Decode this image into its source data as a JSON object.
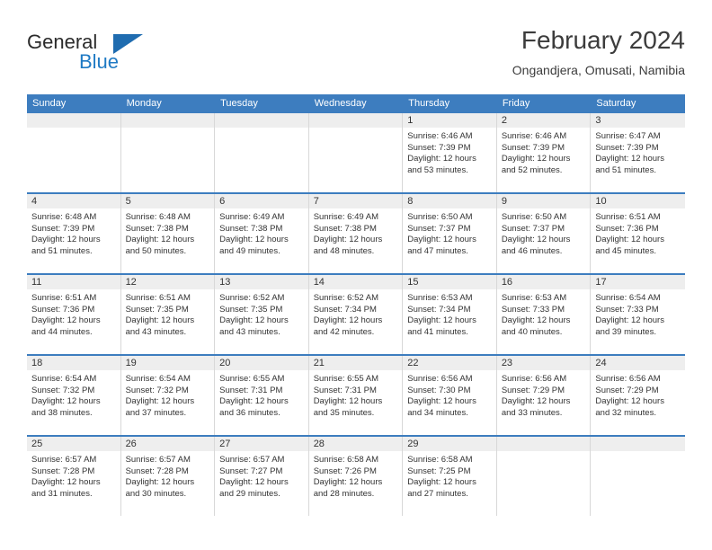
{
  "brand": {
    "line1": "General",
    "line2": "Blue",
    "triangle_icon": "triangle-icon",
    "accent_color": "#1f7ac4"
  },
  "header": {
    "title": "February 2024",
    "subtitle": "Ongandjera, Omusati, Namibia"
  },
  "calendar": {
    "header_color": "#3d7dbf",
    "daynum_bg": "#eeeeee",
    "weekdays": [
      "Sunday",
      "Monday",
      "Tuesday",
      "Wednesday",
      "Thursday",
      "Friday",
      "Saturday"
    ],
    "weeks": [
      [
        {
          "day": "",
          "empty": true
        },
        {
          "day": "",
          "empty": true
        },
        {
          "day": "",
          "empty": true
        },
        {
          "day": "",
          "empty": true
        },
        {
          "day": "1",
          "sunrise": "Sunrise: 6:46 AM",
          "sunset": "Sunset: 7:39 PM",
          "daylight": "Daylight: 12 hours and 53 minutes."
        },
        {
          "day": "2",
          "sunrise": "Sunrise: 6:46 AM",
          "sunset": "Sunset: 7:39 PM",
          "daylight": "Daylight: 12 hours and 52 minutes."
        },
        {
          "day": "3",
          "sunrise": "Sunrise: 6:47 AM",
          "sunset": "Sunset: 7:39 PM",
          "daylight": "Daylight: 12 hours and 51 minutes."
        }
      ],
      [
        {
          "day": "4",
          "sunrise": "Sunrise: 6:48 AM",
          "sunset": "Sunset: 7:39 PM",
          "daylight": "Daylight: 12 hours and 51 minutes."
        },
        {
          "day": "5",
          "sunrise": "Sunrise: 6:48 AM",
          "sunset": "Sunset: 7:38 PM",
          "daylight": "Daylight: 12 hours and 50 minutes."
        },
        {
          "day": "6",
          "sunrise": "Sunrise: 6:49 AM",
          "sunset": "Sunset: 7:38 PM",
          "daylight": "Daylight: 12 hours and 49 minutes."
        },
        {
          "day": "7",
          "sunrise": "Sunrise: 6:49 AM",
          "sunset": "Sunset: 7:38 PM",
          "daylight": "Daylight: 12 hours and 48 minutes."
        },
        {
          "day": "8",
          "sunrise": "Sunrise: 6:50 AM",
          "sunset": "Sunset: 7:37 PM",
          "daylight": "Daylight: 12 hours and 47 minutes."
        },
        {
          "day": "9",
          "sunrise": "Sunrise: 6:50 AM",
          "sunset": "Sunset: 7:37 PM",
          "daylight": "Daylight: 12 hours and 46 minutes."
        },
        {
          "day": "10",
          "sunrise": "Sunrise: 6:51 AM",
          "sunset": "Sunset: 7:36 PM",
          "daylight": "Daylight: 12 hours and 45 minutes."
        }
      ],
      [
        {
          "day": "11",
          "sunrise": "Sunrise: 6:51 AM",
          "sunset": "Sunset: 7:36 PM",
          "daylight": "Daylight: 12 hours and 44 minutes."
        },
        {
          "day": "12",
          "sunrise": "Sunrise: 6:51 AM",
          "sunset": "Sunset: 7:35 PM",
          "daylight": "Daylight: 12 hours and 43 minutes."
        },
        {
          "day": "13",
          "sunrise": "Sunrise: 6:52 AM",
          "sunset": "Sunset: 7:35 PM",
          "daylight": "Daylight: 12 hours and 43 minutes."
        },
        {
          "day": "14",
          "sunrise": "Sunrise: 6:52 AM",
          "sunset": "Sunset: 7:34 PM",
          "daylight": "Daylight: 12 hours and 42 minutes."
        },
        {
          "day": "15",
          "sunrise": "Sunrise: 6:53 AM",
          "sunset": "Sunset: 7:34 PM",
          "daylight": "Daylight: 12 hours and 41 minutes."
        },
        {
          "day": "16",
          "sunrise": "Sunrise: 6:53 AM",
          "sunset": "Sunset: 7:33 PM",
          "daylight": "Daylight: 12 hours and 40 minutes."
        },
        {
          "day": "17",
          "sunrise": "Sunrise: 6:54 AM",
          "sunset": "Sunset: 7:33 PM",
          "daylight": "Daylight: 12 hours and 39 minutes."
        }
      ],
      [
        {
          "day": "18",
          "sunrise": "Sunrise: 6:54 AM",
          "sunset": "Sunset: 7:32 PM",
          "daylight": "Daylight: 12 hours and 38 minutes."
        },
        {
          "day": "19",
          "sunrise": "Sunrise: 6:54 AM",
          "sunset": "Sunset: 7:32 PM",
          "daylight": "Daylight: 12 hours and 37 minutes."
        },
        {
          "day": "20",
          "sunrise": "Sunrise: 6:55 AM",
          "sunset": "Sunset: 7:31 PM",
          "daylight": "Daylight: 12 hours and 36 minutes."
        },
        {
          "day": "21",
          "sunrise": "Sunrise: 6:55 AM",
          "sunset": "Sunset: 7:31 PM",
          "daylight": "Daylight: 12 hours and 35 minutes."
        },
        {
          "day": "22",
          "sunrise": "Sunrise: 6:56 AM",
          "sunset": "Sunset: 7:30 PM",
          "daylight": "Daylight: 12 hours and 34 minutes."
        },
        {
          "day": "23",
          "sunrise": "Sunrise: 6:56 AM",
          "sunset": "Sunset: 7:29 PM",
          "daylight": "Daylight: 12 hours and 33 minutes."
        },
        {
          "day": "24",
          "sunrise": "Sunrise: 6:56 AM",
          "sunset": "Sunset: 7:29 PM",
          "daylight": "Daylight: 12 hours and 32 minutes."
        }
      ],
      [
        {
          "day": "25",
          "sunrise": "Sunrise: 6:57 AM",
          "sunset": "Sunset: 7:28 PM",
          "daylight": "Daylight: 12 hours and 31 minutes."
        },
        {
          "day": "26",
          "sunrise": "Sunrise: 6:57 AM",
          "sunset": "Sunset: 7:28 PM",
          "daylight": "Daylight: 12 hours and 30 minutes."
        },
        {
          "day": "27",
          "sunrise": "Sunrise: 6:57 AM",
          "sunset": "Sunset: 7:27 PM",
          "daylight": "Daylight: 12 hours and 29 minutes."
        },
        {
          "day": "28",
          "sunrise": "Sunrise: 6:58 AM",
          "sunset": "Sunset: 7:26 PM",
          "daylight": "Daylight: 12 hours and 28 minutes."
        },
        {
          "day": "29",
          "sunrise": "Sunrise: 6:58 AM",
          "sunset": "Sunset: 7:25 PM",
          "daylight": "Daylight: 12 hours and 27 minutes."
        },
        {
          "day": "",
          "empty": true
        },
        {
          "day": "",
          "empty": true
        }
      ]
    ]
  }
}
